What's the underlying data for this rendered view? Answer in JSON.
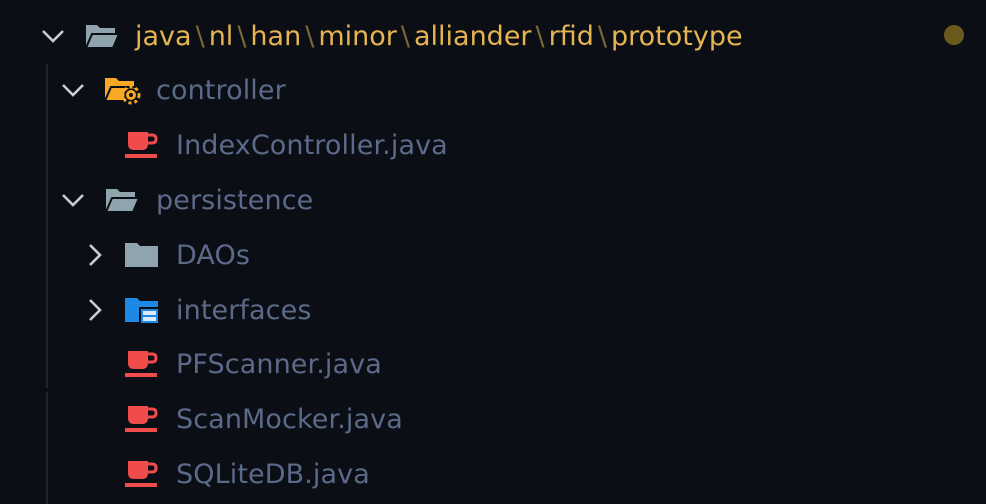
{
  "colors": {
    "background": "#0b0e14",
    "path_text": "#e6b450",
    "separator": "#7a6a35",
    "item_text": "#5c6a8a",
    "java_icon": "#f14c4c",
    "folder_icon": "#90a4ae",
    "interfaces_folder": "#1e88e5",
    "controller_folder": "#f9a825",
    "modified_dot": "#6b5a1e"
  },
  "root": {
    "segments": [
      "java",
      "nl",
      "han",
      "minor",
      "alliander",
      "rfid",
      "prototype"
    ],
    "separator": "\\",
    "expanded": true,
    "icon": "folder-open-icon"
  },
  "tree": [
    {
      "label": "controller",
      "type": "folder",
      "expanded": true,
      "icon": "folder-controller-open-icon"
    },
    {
      "label": "IndexController.java",
      "type": "file",
      "icon": "java-file-icon"
    },
    {
      "label": "persistence",
      "type": "folder",
      "expanded": true,
      "icon": "folder-open-icon"
    },
    {
      "label": "DAOs",
      "type": "folder",
      "expanded": false,
      "icon": "folder-icon"
    },
    {
      "label": "interfaces",
      "type": "folder",
      "expanded": false,
      "icon": "folder-interfaces-icon"
    },
    {
      "label": "PFScanner.java",
      "type": "file",
      "icon": "java-file-icon"
    },
    {
      "label": "ScanMocker.java",
      "type": "file",
      "icon": "java-file-icon"
    },
    {
      "label": "SQLiteDB.java",
      "type": "file",
      "icon": "java-file-icon"
    }
  ]
}
